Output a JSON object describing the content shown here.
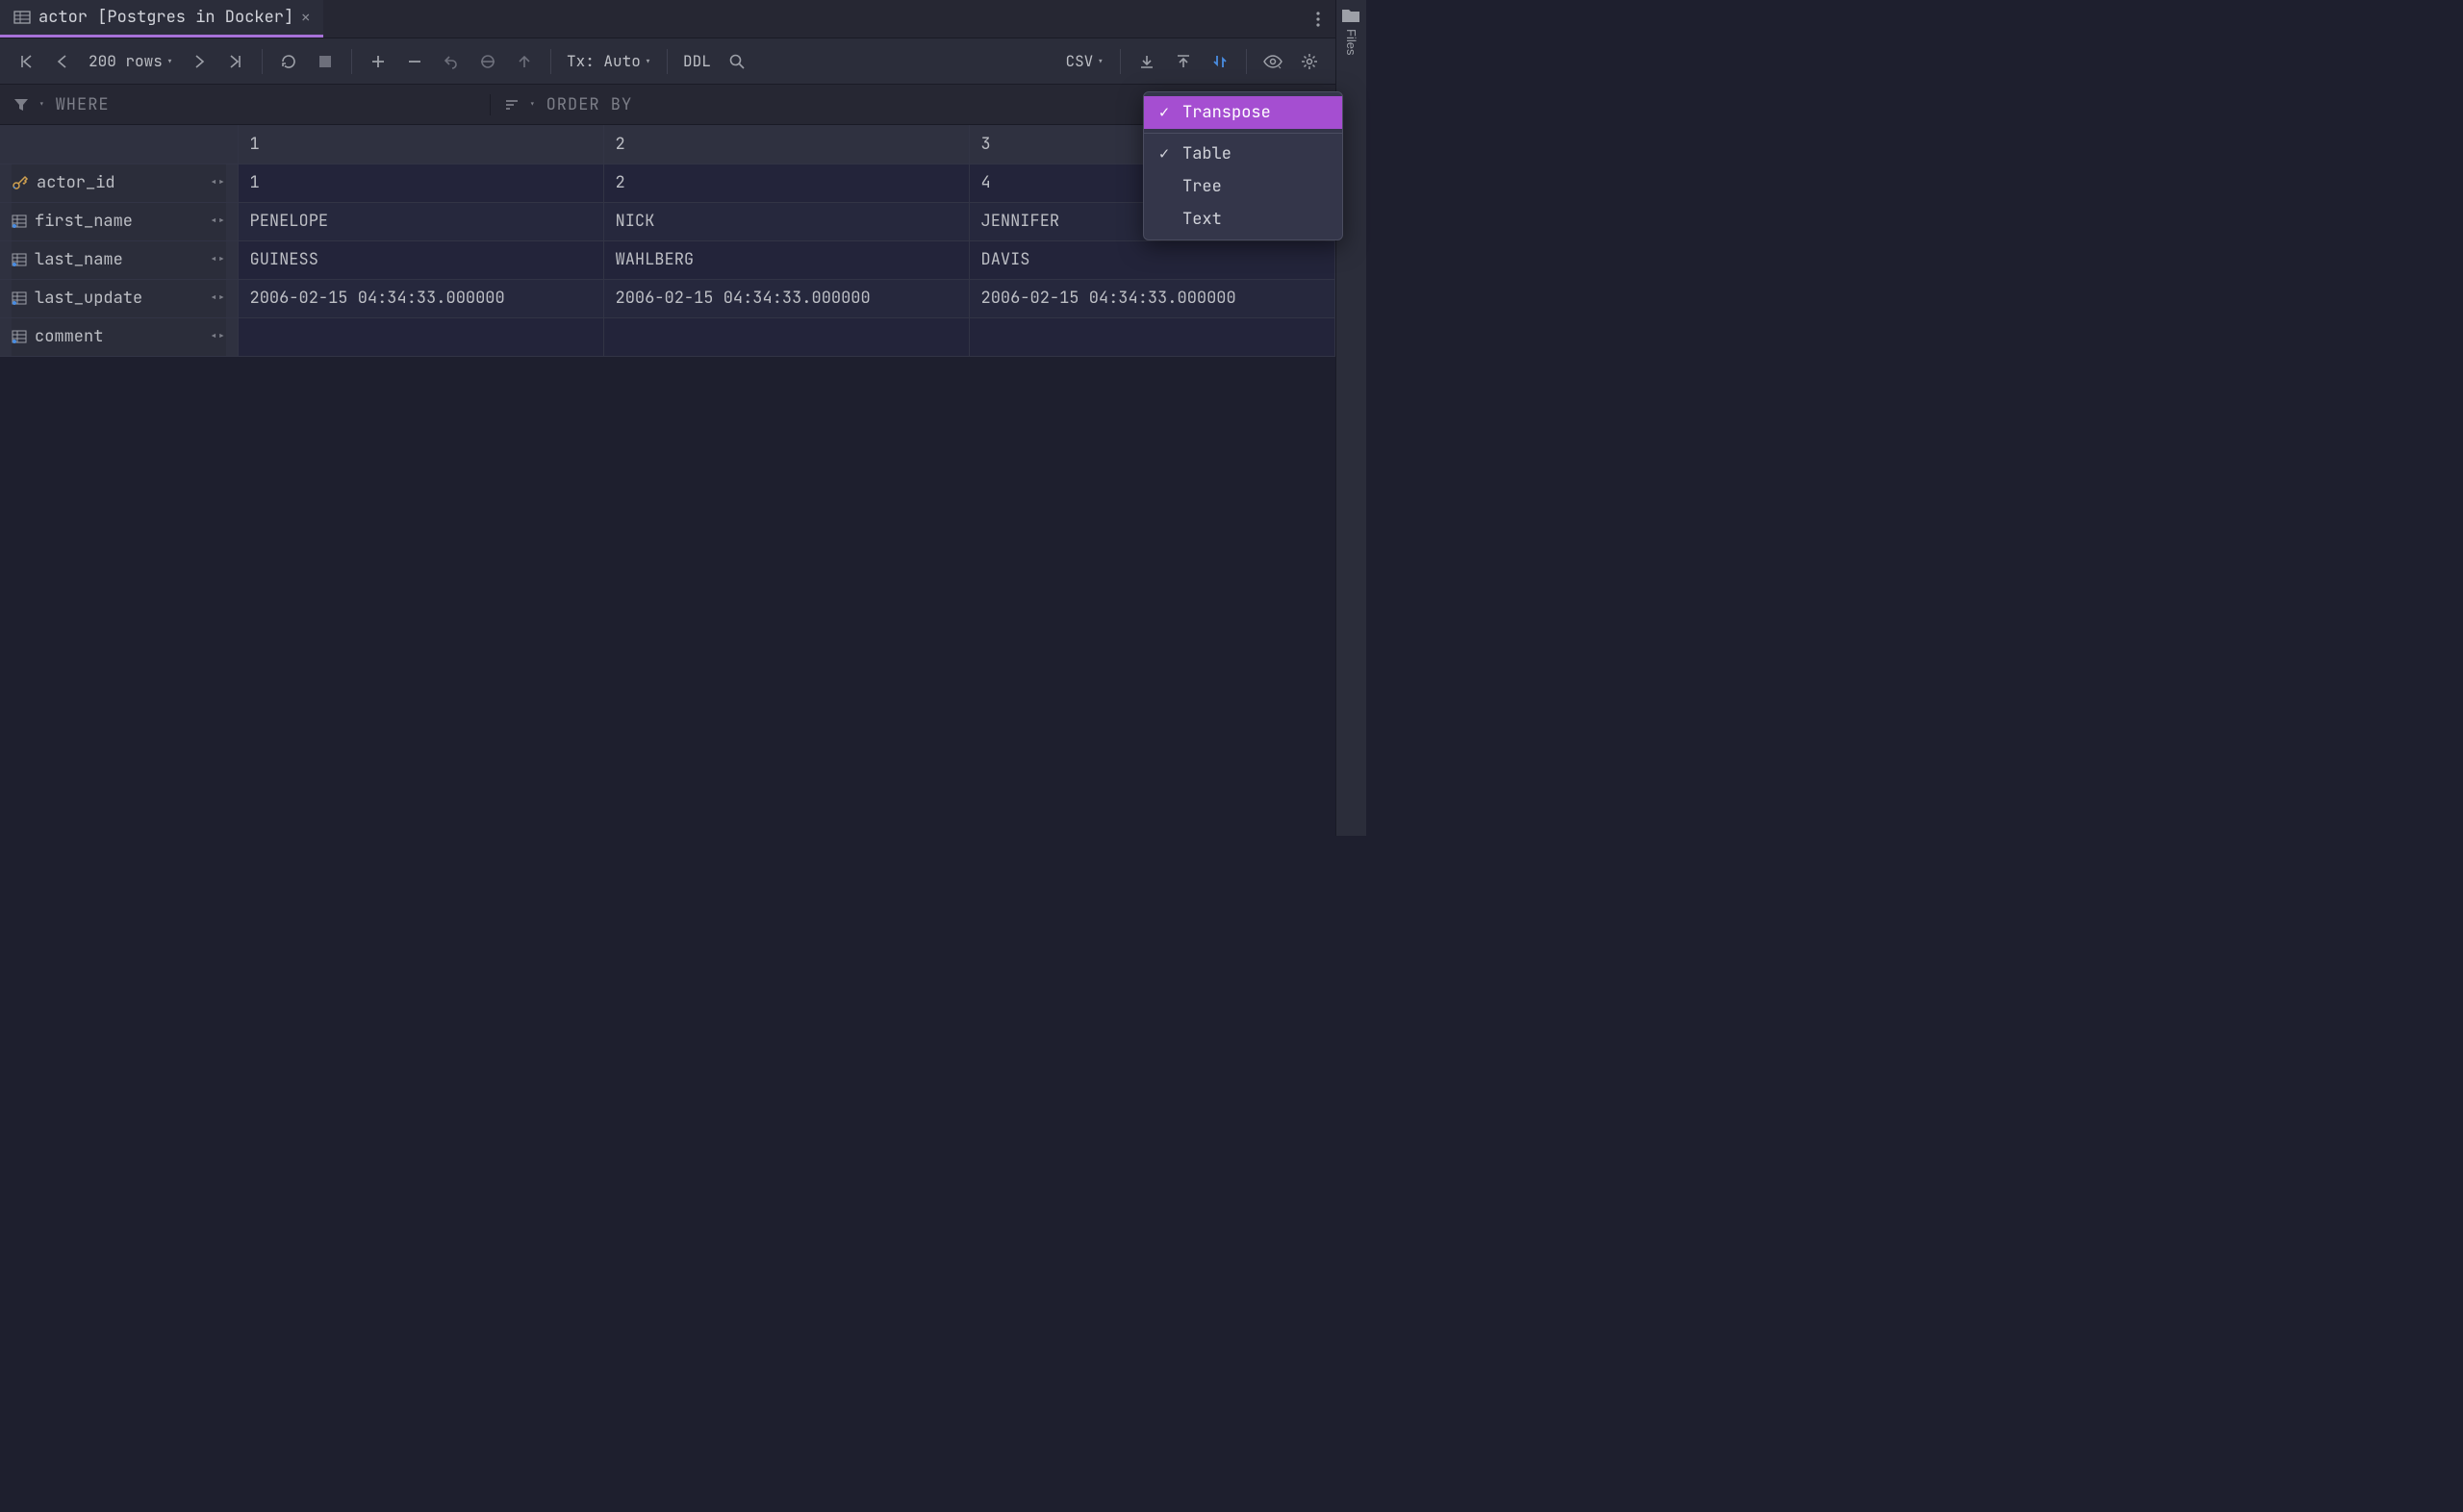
{
  "tab": {
    "title": "actor [Postgres in Docker]"
  },
  "toolbar": {
    "rowcount": "200 rows",
    "tx": "Tx: Auto",
    "ddl": "DDL",
    "export_format": "CSV"
  },
  "filter": {
    "where": "WHERE",
    "order": "ORDER BY"
  },
  "sidebar": {
    "files": "Files"
  },
  "menu": {
    "items": [
      {
        "label": "Transpose",
        "checked": true,
        "selected": true
      },
      {
        "label": "Table",
        "checked": true,
        "selected": false
      },
      {
        "label": "Tree",
        "checked": false,
        "selected": false
      },
      {
        "label": "Text",
        "checked": false,
        "selected": false
      }
    ]
  },
  "grid": {
    "col_headers": [
      "1",
      "2",
      "3"
    ],
    "row_fields": [
      {
        "name": "actor_id",
        "icon": "key"
      },
      {
        "name": "first_name",
        "icon": "col"
      },
      {
        "name": "last_name",
        "icon": "col"
      },
      {
        "name": "last_update",
        "icon": "col"
      },
      {
        "name": "comment",
        "icon": "col"
      }
    ],
    "cells": [
      [
        "1",
        "2",
        "4"
      ],
      [
        "PENELOPE",
        "NICK",
        "JENNIFER"
      ],
      [
        "GUINESS",
        "WAHLBERG",
        "DAVIS"
      ],
      [
        "2006-02-15 04:34:33.000000",
        "2006-02-15 04:34:33.000000",
        "2006-02-15 04:34:33.000000"
      ],
      [
        "<null>",
        "<null>",
        "<null>"
      ]
    ],
    "null_rows": [
      4
    ]
  }
}
